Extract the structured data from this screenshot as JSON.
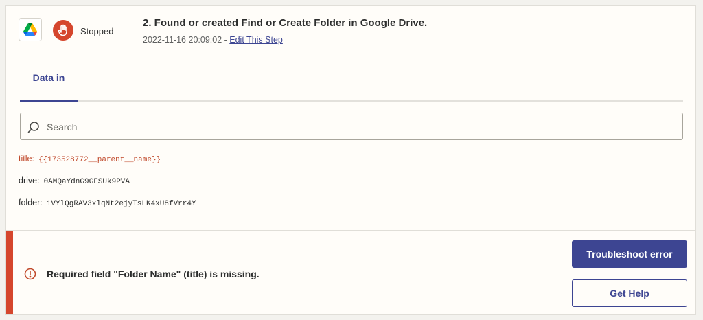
{
  "header": {
    "status": "Stopped",
    "step_title": "2. Found or created Find or Create Folder in Google Drive.",
    "timestamp": "2022-11-16 20:09:02",
    "separator": " - ",
    "edit_link": "Edit This Step"
  },
  "tabs": [
    {
      "label": "Data in",
      "active": true
    }
  ],
  "search": {
    "placeholder": "Search",
    "value": ""
  },
  "fields": [
    {
      "key": "title:",
      "value": "{{173528772__parent__name}}",
      "error": true
    },
    {
      "key": "drive:",
      "value": "0AMQaYdnG9GFSUk9PVA",
      "error": false
    },
    {
      "key": "folder:",
      "value": "1VYlQgRAV3xlqNt2ejyTsLK4xU8fVrr4Y",
      "error": false
    }
  ],
  "error": {
    "message": "Required field \"Folder Name\" (title) is missing.",
    "troubleshoot_label": "Troubleshoot error",
    "help_label": "Get Help"
  },
  "colors": {
    "accent": "#3d4592",
    "error": "#d5462d",
    "background": "#fffdf9"
  },
  "icons": {
    "app": "google-drive-icon",
    "status": "stop-hand-icon",
    "search": "search-icon",
    "error": "alert-circle-icon"
  }
}
